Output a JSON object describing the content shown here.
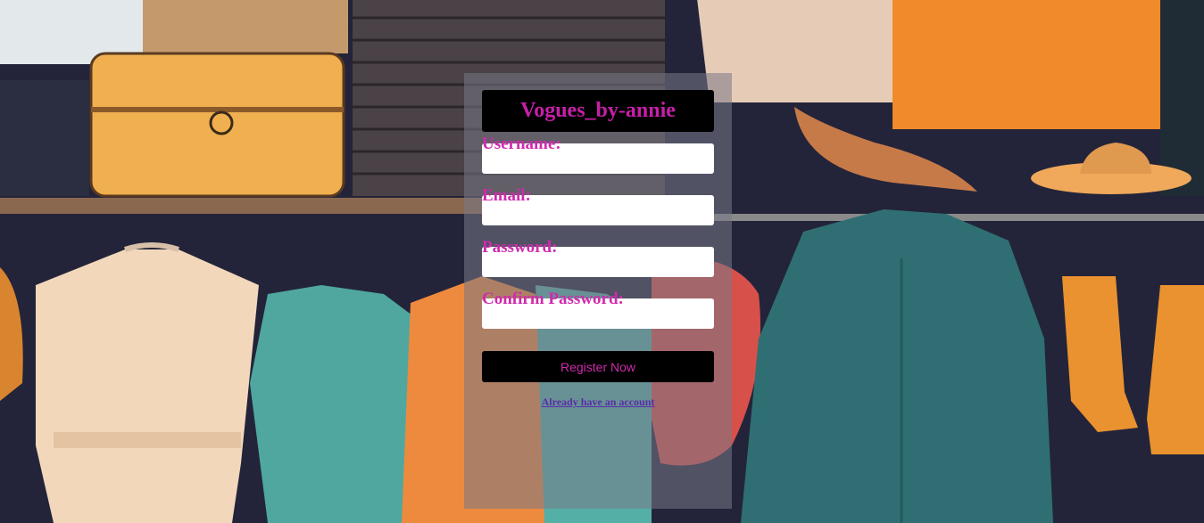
{
  "brand": {
    "title": "Vogues_by-annie"
  },
  "form": {
    "username": {
      "label": "Username:",
      "value": "",
      "placeholder": ""
    },
    "email": {
      "label": "Email:",
      "value": "",
      "placeholder": ""
    },
    "password": {
      "label": "Password:",
      "value": "",
      "placeholder": ""
    },
    "confirm_password": {
      "label": "Confirm Password:",
      "value": "",
      "placeholder": ""
    },
    "submit_label": "Register Now",
    "login_link": "Already have an account"
  },
  "colors": {
    "accent": "#d02aad",
    "panel": "#787887",
    "button": "#000000",
    "link": "#5a2ca8"
  }
}
